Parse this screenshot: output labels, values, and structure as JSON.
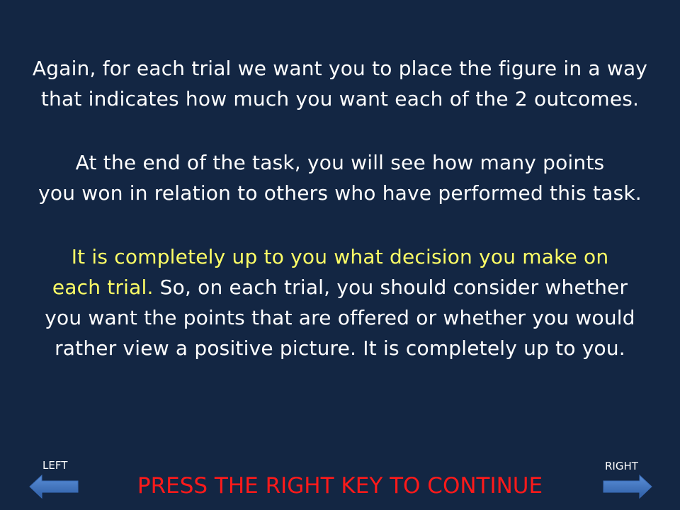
{
  "instructions": {
    "paragraph1": [
      "Again, for each trial we want you to place the figure in a way",
      "that indicates how much you want each of the 2 outcomes."
    ],
    "paragraph2": [
      "At the end of the task, you will see how many points",
      "you won in relation to others who have performed this task."
    ],
    "paragraph3": {
      "line1_highlight": "It is completely up to you what decision you make on",
      "line2_highlight": "each trial.",
      "line2_rest": " So, on each trial, you should consider whether",
      "line3": "you want the points that are offered or whether you would",
      "line4": "rather view a positive picture. It is completely up to you."
    }
  },
  "navigation": {
    "left_label": "LEFT",
    "right_label": "RIGHT",
    "continue_prompt": "PRESS THE RIGHT KEY TO CONTINUE",
    "left_icon": "arrow-left-icon",
    "right_icon": "arrow-right-icon"
  },
  "colors": {
    "background": "#132643",
    "text": "#ffffff",
    "highlight": "#ffff66",
    "prompt": "#ff1a1a",
    "arrow": "#4472c4"
  }
}
